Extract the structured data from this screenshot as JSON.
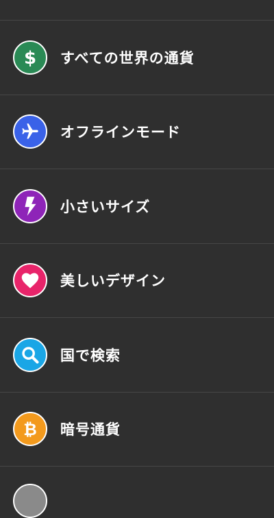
{
  "features": {
    "items": [
      {
        "label": "すべての世界の通貨",
        "icon": "dollar-icon",
        "color": "#2a8a55"
      },
      {
        "label": "オフラインモード",
        "icon": "airplane-icon",
        "color": "#3a62e8"
      },
      {
        "label": "小さいサイズ",
        "icon": "lightning-icon",
        "color": "#8e24b8"
      },
      {
        "label": "美しいデザイン",
        "icon": "heart-icon",
        "color": "#e8246a"
      },
      {
        "label": "国で検索",
        "icon": "search-icon",
        "color": "#1aa6e6"
      },
      {
        "label": "暗号通貨",
        "icon": "bitcoin-icon",
        "color": "#f39a1d"
      }
    ]
  }
}
